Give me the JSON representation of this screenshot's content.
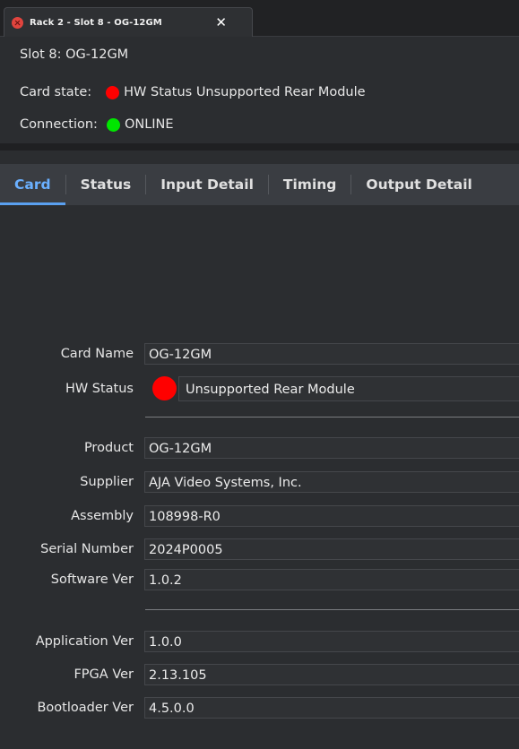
{
  "window": {
    "tab_title": "Rack 2 - Slot 8 - OG-12GM",
    "tab_close_symbol": "✕"
  },
  "header": {
    "slot_text": "Slot 8: OG-12GM",
    "card_state_label": "Card state:",
    "card_state_value": "HW Status Unsupported Rear Module",
    "card_state_color": "#ff0000",
    "connection_label": "Connection:",
    "connection_value": "ONLINE",
    "connection_color": "#00e600"
  },
  "tabs": [
    {
      "label": "Card",
      "active": true
    },
    {
      "label": "Status",
      "active": false
    },
    {
      "label": "Input Detail",
      "active": false
    },
    {
      "label": "Timing",
      "active": false
    },
    {
      "label": "Output Detail",
      "active": false
    }
  ],
  "fields": {
    "card_name": {
      "label": "Card Name",
      "value": "OG-12GM"
    },
    "hw_status": {
      "label": "HW Status",
      "value": "Unsupported Rear Module",
      "color": "#ff0000"
    },
    "product": {
      "label": "Product",
      "value": "OG-12GM"
    },
    "supplier": {
      "label": "Supplier",
      "value": "AJA Video Systems, Inc."
    },
    "assembly": {
      "label": "Assembly",
      "value": "108998-R0"
    },
    "serial_number": {
      "label": "Serial Number",
      "value": "2024P0005"
    },
    "software_ver": {
      "label": "Software Ver",
      "value": "1.0.2"
    },
    "application_ver": {
      "label": "Application Ver",
      "value": "1.0.0"
    },
    "fpga_ver": {
      "label": "FPGA Ver",
      "value": "2.13.105"
    },
    "bootloader_ver": {
      "label": "Bootloader Ver",
      "value": "4.5.0.0"
    }
  },
  "colors": {
    "accent": "#5aa0f0",
    "background": "#2b2d30",
    "tabbar": "#3a3d42"
  }
}
